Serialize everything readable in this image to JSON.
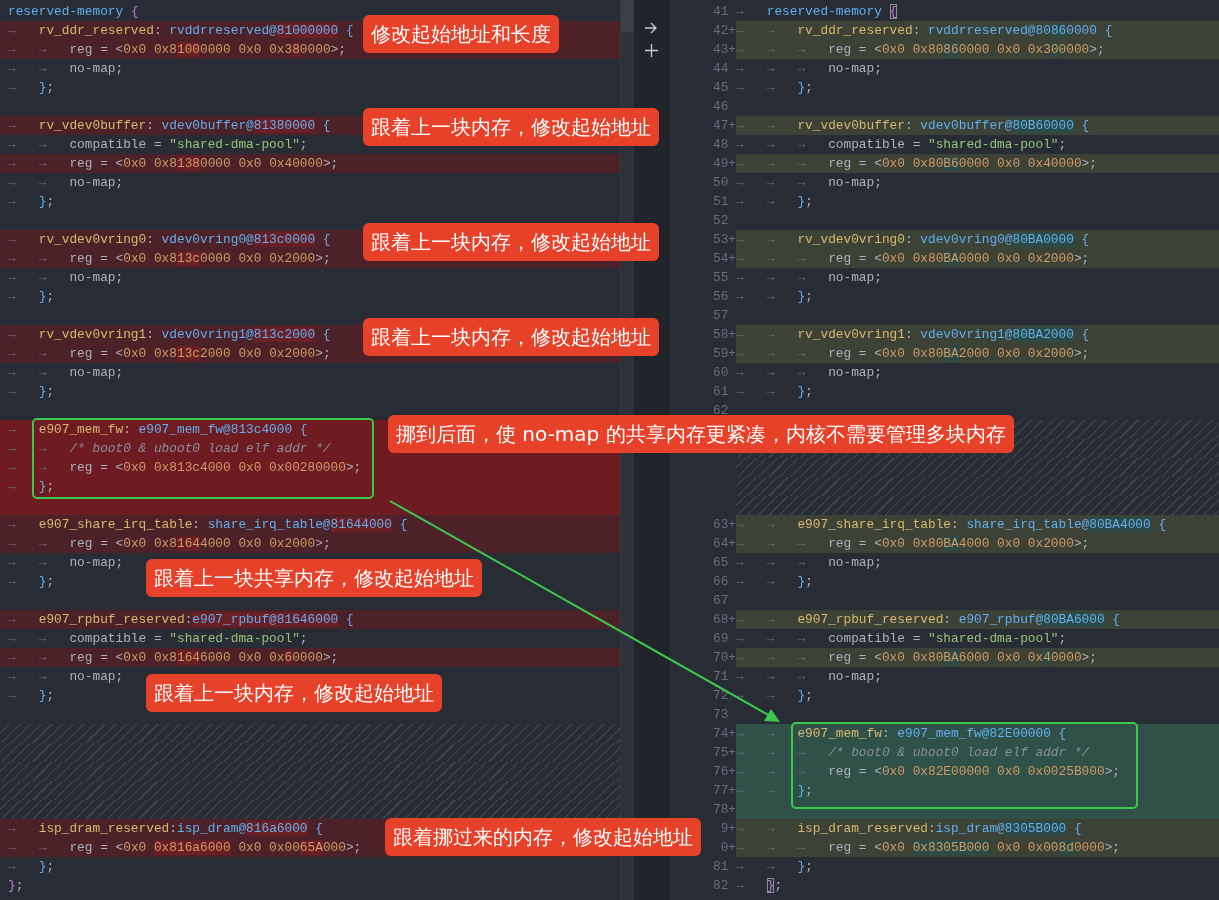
{
  "left_pane": {
    "lines": [
      {
        "kind": "normal",
        "segments": [
          {
            "text": "reserved-memory ",
            "kind": "label",
            "changed": false
          },
          {
            "text": "{",
            "kind": "bracket",
            "changed": false
          }
        ]
      },
      {
        "kind": "removed",
        "indent": "→   ",
        "segments": [
          {
            "text": "rv_ddr_reserved",
            "kind": "key",
            "changed": false
          },
          {
            "text": ": ",
            "kind": "plain",
            "changed": false
          },
          {
            "text": "rvddrreserved@",
            "kind": "label",
            "changed": false
          },
          {
            "text": "81000000",
            "kind": "label",
            "changed": true
          },
          {
            "text": " {",
            "kind": "brace",
            "changed": false
          }
        ]
      },
      {
        "kind": "removed",
        "indent": "→   →   ",
        "segments": [
          {
            "text": "reg = <",
            "kind": "plain",
            "changed": false
          },
          {
            "text": "0x0 0x8",
            "kind": "number",
            "changed": false
          },
          {
            "text": "100",
            "kind": "number",
            "changed": true
          },
          {
            "text": "0000 0x0 0x3",
            "kind": "number",
            "changed": false
          },
          {
            "text": "8",
            "kind": "number",
            "changed": true
          },
          {
            "text": "0000",
            "kind": "number",
            "changed": false
          },
          {
            "text": ">;",
            "kind": "plain",
            "changed": false
          }
        ]
      },
      {
        "kind": "normal",
        "indent": "→   →   ",
        "segments": [
          {
            "text": "no-map;",
            "kind": "plain",
            "changed": false
          }
        ]
      },
      {
        "kind": "normal",
        "indent": "→   ",
        "segments": [
          {
            "text": "}",
            "kind": "brace",
            "changed": false
          },
          {
            "text": ";",
            "kind": "plain",
            "changed": false
          }
        ]
      },
      {
        "kind": "normal"
      },
      {
        "kind": "removed",
        "indent": "→   ",
        "segments": [
          {
            "text": "rv_vdev0buffer",
            "kind": "key",
            "changed": false
          },
          {
            "text": ": ",
            "kind": "plain",
            "changed": false
          },
          {
            "text": "vdev0buffer@",
            "kind": "label",
            "changed": false
          },
          {
            "text": "81380000",
            "kind": "label",
            "changed": true
          },
          {
            "text": " {",
            "kind": "brace",
            "changed": false
          }
        ]
      },
      {
        "kind": "normal",
        "indent": "→   →   ",
        "segments": [
          {
            "text": "compatible = ",
            "kind": "plain",
            "changed": false
          },
          {
            "text": "\"shared-dma-pool\"",
            "kind": "string",
            "changed": false
          },
          {
            "text": ";",
            "kind": "plain",
            "changed": false
          }
        ]
      },
      {
        "kind": "removed",
        "indent": "→   →   ",
        "segments": [
          {
            "text": "reg = <",
            "kind": "plain",
            "changed": false
          },
          {
            "text": "0x0 0x8",
            "kind": "number",
            "changed": false
          },
          {
            "text": "138",
            "kind": "number",
            "changed": true
          },
          {
            "text": "0000 0x0 0x40000",
            "kind": "number",
            "changed": false
          },
          {
            "text": ">;",
            "kind": "plain",
            "changed": false
          }
        ]
      },
      {
        "kind": "normal",
        "indent": "→   →   ",
        "segments": [
          {
            "text": "no-map;",
            "kind": "plain",
            "changed": false
          }
        ]
      },
      {
        "kind": "normal",
        "indent": "→   ",
        "segments": [
          {
            "text": "}",
            "kind": "brace",
            "changed": false
          },
          {
            "text": ";",
            "kind": "plain",
            "changed": false
          }
        ]
      },
      {
        "kind": "normal"
      },
      {
        "kind": "removed",
        "indent": "→   ",
        "segments": [
          {
            "text": "rv_vdev0vring0",
            "kind": "key",
            "changed": false
          },
          {
            "text": ": ",
            "kind": "plain",
            "changed": false
          },
          {
            "text": "vdev0vring0@",
            "kind": "label",
            "changed": false
          },
          {
            "text": "813c0000",
            "kind": "label",
            "changed": true
          },
          {
            "text": " {",
            "kind": "brace",
            "changed": false
          }
        ]
      },
      {
        "kind": "removed",
        "indent": "→   →   ",
        "segments": [
          {
            "text": "reg = <",
            "kind": "plain",
            "changed": false
          },
          {
            "text": "0x0 0x8",
            "kind": "number",
            "changed": false
          },
          {
            "text": "13c",
            "kind": "number",
            "changed": true
          },
          {
            "text": "0000 0x0 0x2000",
            "kind": "number",
            "changed": false
          },
          {
            "text": ">;",
            "kind": "plain",
            "changed": false
          }
        ]
      },
      {
        "kind": "normal",
        "indent": "→   →   ",
        "segments": [
          {
            "text": "no-map;",
            "kind": "plain",
            "changed": false
          }
        ]
      },
      {
        "kind": "normal",
        "indent": "→   ",
        "segments": [
          {
            "text": "}",
            "kind": "brace",
            "changed": false
          },
          {
            "text": ";",
            "kind": "plain",
            "changed": false
          }
        ]
      },
      {
        "kind": "normal"
      },
      {
        "kind": "removed",
        "indent": "→   ",
        "segments": [
          {
            "text": "rv_vdev0vring1",
            "kind": "key",
            "changed": false
          },
          {
            "text": ": ",
            "kind": "plain",
            "changed": false
          },
          {
            "text": "vdev0vring1@",
            "kind": "label",
            "changed": false
          },
          {
            "text": "813c2000",
            "kind": "label",
            "changed": true
          },
          {
            "text": " {",
            "kind": "brace",
            "changed": false
          }
        ]
      },
      {
        "kind": "removed",
        "indent": "→   →   ",
        "segments": [
          {
            "text": "reg = <",
            "kind": "plain",
            "changed": false
          },
          {
            "text": "0x0 0x8",
            "kind": "number",
            "changed": false
          },
          {
            "text": "13c",
            "kind": "number",
            "changed": true
          },
          {
            "text": "2000 0x0 0x2000",
            "kind": "number",
            "changed": false
          },
          {
            "text": ">;",
            "kind": "plain",
            "changed": false
          }
        ]
      },
      {
        "kind": "normal",
        "indent": "→   →   ",
        "segments": [
          {
            "text": "no-map;",
            "kind": "plain",
            "changed": false
          }
        ]
      },
      {
        "kind": "normal",
        "indent": "→   ",
        "segments": [
          {
            "text": "}",
            "kind": "brace",
            "changed": false
          },
          {
            "text": ";",
            "kind": "plain",
            "changed": false
          }
        ]
      },
      {
        "kind": "normal"
      },
      {
        "kind": "deleted",
        "indent": "→   ",
        "segments": [
          {
            "text": "e907_mem_fw",
            "kind": "key"
          },
          {
            "text": ": ",
            "kind": "plain"
          },
          {
            "text": "e907_mem_fw@813c4000",
            "kind": "label"
          },
          {
            "text": " {",
            "kind": "brace"
          }
        ]
      },
      {
        "kind": "deleted",
        "indent": "→   →   ",
        "segments": [
          {
            "text": "/* boot0 & uboot0 load elf addr */",
            "kind": "comment"
          }
        ]
      },
      {
        "kind": "deleted",
        "indent": "→   →   ",
        "segments": [
          {
            "text": "reg = <",
            "kind": "plain"
          },
          {
            "text": "0x0 0x813c4000 0x0 0x00280000",
            "kind": "number"
          },
          {
            "text": ">;",
            "kind": "plain"
          }
        ]
      },
      {
        "kind": "deleted",
        "indent": "→   ",
        "segments": [
          {
            "text": "}",
            "kind": "brace"
          },
          {
            "text": ";",
            "kind": "plain"
          }
        ]
      },
      {
        "kind": "deleted"
      },
      {
        "kind": "removed",
        "indent": "→   ",
        "segments": [
          {
            "text": "e907_share_irq_table",
            "kind": "key",
            "changed": false
          },
          {
            "text": ": ",
            "kind": "plain",
            "changed": false
          },
          {
            "text": "share_irq_table@",
            "kind": "label",
            "changed": false
          },
          {
            "text": "81644000",
            "kind": "label",
            "changed": true
          },
          {
            "text": " {",
            "kind": "brace",
            "changed": false
          }
        ]
      },
      {
        "kind": "removed",
        "indent": "→   →   ",
        "segments": [
          {
            "text": "reg = <",
            "kind": "plain",
            "changed": false
          },
          {
            "text": "0x0 0x8",
            "kind": "number",
            "changed": false
          },
          {
            "text": "164",
            "kind": "number",
            "changed": true
          },
          {
            "text": "4000 0x0 0x2000",
            "kind": "number",
            "changed": false
          },
          {
            "text": ">;",
            "kind": "plain",
            "changed": false
          }
        ]
      },
      {
        "kind": "normal",
        "indent": "→   →   ",
        "segments": [
          {
            "text": "no-map;",
            "kind": "plain",
            "changed": false
          }
        ]
      },
      {
        "kind": "normal",
        "indent": "→   ",
        "segments": [
          {
            "text": "}",
            "kind": "brace",
            "changed": false
          },
          {
            "text": ";",
            "kind": "plain",
            "changed": false
          }
        ]
      },
      {
        "kind": "normal"
      },
      {
        "kind": "removed",
        "indent": "→   ",
        "segments": [
          {
            "text": "e907_rpbuf_reserved",
            "kind": "key",
            "changed": false
          },
          {
            "text": ":",
            "kind": "plain",
            "changed": false
          },
          {
            "text": "e907_rpbuf@81646000",
            "kind": "label",
            "changed": true
          },
          {
            "text": " {",
            "kind": "brace",
            "changed": false
          }
        ]
      },
      {
        "kind": "normal",
        "indent": "→   →   ",
        "segments": [
          {
            "text": "compatible = ",
            "kind": "plain",
            "changed": false
          },
          {
            "text": "\"shared-dma-pool\"",
            "kind": "string",
            "changed": false
          },
          {
            "text": ";",
            "kind": "plain",
            "changed": false
          }
        ]
      },
      {
        "kind": "removed",
        "indent": "→   →   ",
        "segments": [
          {
            "text": "reg = <",
            "kind": "plain",
            "changed": false
          },
          {
            "text": "0x0 0x8",
            "kind": "number",
            "changed": false
          },
          {
            "text": "164",
            "kind": "number",
            "changed": true
          },
          {
            "text": "6000 0x0 0x",
            "kind": "number",
            "changed": false
          },
          {
            "text": "6",
            "kind": "number",
            "changed": true
          },
          {
            "text": "0000",
            "kind": "number",
            "changed": false
          },
          {
            "text": ">;",
            "kind": "plain",
            "changed": false
          }
        ]
      },
      {
        "kind": "normal",
        "indent": "→   →   ",
        "segments": [
          {
            "text": "no-map;",
            "kind": "plain",
            "changed": false
          }
        ]
      },
      {
        "kind": "normal",
        "indent": "→   ",
        "segments": [
          {
            "text": "}",
            "kind": "brace",
            "changed": false
          },
          {
            "text": ";",
            "kind": "plain",
            "changed": false
          }
        ]
      },
      {
        "kind": "normal"
      },
      {
        "kind": "filler"
      },
      {
        "kind": "filler"
      },
      {
        "kind": "filler"
      },
      {
        "kind": "filler"
      },
      {
        "kind": "filler"
      },
      {
        "kind": "removed",
        "indent": "→   ",
        "segments": [
          {
            "text": "isp_dram_reserved",
            "kind": "key",
            "changed": false
          },
          {
            "text": ":",
            "kind": "plain",
            "changed": false
          },
          {
            "text": "isp_dram@",
            "kind": "label",
            "changed": false
          },
          {
            "text": "816a6000",
            "kind": "label",
            "changed": true
          },
          {
            "text": " {",
            "kind": "brace",
            "changed": false
          }
        ]
      },
      {
        "kind": "removed",
        "indent": "→   →   ",
        "segments": [
          {
            "text": "reg = <",
            "kind": "plain",
            "changed": false
          },
          {
            "text": "0x0 ",
            "kind": "number",
            "changed": false
          },
          {
            "text": "0x816a6000",
            "kind": "number",
            "changed": true
          },
          {
            "text": " 0x0 0x00",
            "kind": "number",
            "changed": false
          },
          {
            "text": "65A",
            "kind": "number",
            "changed": true
          },
          {
            "text": "000",
            "kind": "number",
            "changed": false
          },
          {
            "text": ">;",
            "kind": "plain",
            "changed": false
          }
        ]
      },
      {
        "kind": "normal",
        "indent": "→   ",
        "segments": [
          {
            "text": "}",
            "kind": "brace",
            "changed": false
          },
          {
            "text": ";",
            "kind": "plain",
            "changed": false
          }
        ]
      },
      {
        "kind": "normal",
        "segments": [
          {
            "text": "}",
            "kind": "bracket",
            "changed": false
          },
          {
            "text": ";",
            "kind": "plain",
            "changed": false
          }
        ]
      }
    ]
  },
  "right_pane": {
    "lines": [
      {
        "number": "41",
        "kind": "normal",
        "indent": "→   ",
        "segments": [
          {
            "text": "reserved-memory ",
            "kind": "label",
            "changed": false
          },
          {
            "text": "{",
            "kind": "matched_bracket",
            "changed": false
          }
        ]
      },
      {
        "number": "42+",
        "kind": "added",
        "indent": "→   →   ",
        "segments": [
          {
            "text": "rv_ddr_reserved",
            "kind": "key",
            "changed": false
          },
          {
            "text": ": ",
            "kind": "plain",
            "changed": false
          },
          {
            "text": "rvddrreserved@80",
            "kind": "label",
            "changed": false
          },
          {
            "text": "86",
            "kind": "label",
            "changed": true
          },
          {
            "text": "0000",
            "kind": "label",
            "changed": false
          },
          {
            "text": " {",
            "kind": "brace",
            "changed": false
          }
        ]
      },
      {
        "number": "43+",
        "kind": "added",
        "indent": "→   →   →   ",
        "segments": [
          {
            "text": "reg = <",
            "kind": "plain",
            "changed": false
          },
          {
            "text": "0x0 0x80",
            "kind": "number",
            "changed": false
          },
          {
            "text": "86",
            "kind": "number",
            "changed": true
          },
          {
            "text": "0000 0x0 0x3",
            "kind": "number",
            "changed": false
          },
          {
            "text": "0",
            "kind": "number",
            "changed": true
          },
          {
            "text": "0000",
            "kind": "number",
            "changed": false
          },
          {
            "text": ">;",
            "kind": "plain",
            "changed": false
          }
        ]
      },
      {
        "number": "44",
        "kind": "normal",
        "indent": "→   →   →   ",
        "segments": [
          {
            "text": "no-map;",
            "kind": "plain",
            "changed": false
          }
        ]
      },
      {
        "number": "45",
        "kind": "normal",
        "indent": "→   →   ",
        "segments": [
          {
            "text": "}",
            "kind": "brace",
            "changed": false
          },
          {
            "text": ";",
            "kind": "plain",
            "changed": false
          }
        ]
      },
      {
        "number": "46",
        "kind": "normal"
      },
      {
        "number": "47+",
        "kind": "added",
        "indent": "→   →   ",
        "segments": [
          {
            "text": "rv_vdev0buffer",
            "kind": "key",
            "changed": false
          },
          {
            "text": ": ",
            "kind": "plain",
            "changed": false
          },
          {
            "text": "vdev0buffer@",
            "kind": "label",
            "changed": false
          },
          {
            "text": "80B60000",
            "kind": "label",
            "changed": true
          },
          {
            "text": " {",
            "kind": "brace",
            "changed": false
          }
        ]
      },
      {
        "number": "48",
        "kind": "normal",
        "indent": "→   →   →   ",
        "segments": [
          {
            "text": "compatible = ",
            "kind": "plain",
            "changed": false
          },
          {
            "text": "\"shared-dma-pool\"",
            "kind": "string",
            "changed": false
          },
          {
            "text": ";",
            "kind": "plain",
            "changed": false
          }
        ]
      },
      {
        "number": "49+",
        "kind": "added",
        "indent": "→   →   →   ",
        "segments": [
          {
            "text": "reg = <",
            "kind": "plain",
            "changed": false
          },
          {
            "text": "0x0 0x80",
            "kind": "number",
            "changed": false
          },
          {
            "text": "B6",
            "kind": "number",
            "changed": true
          },
          {
            "text": "0000 0x0 0x40000",
            "kind": "number",
            "changed": false
          },
          {
            "text": ">;",
            "kind": "plain",
            "changed": false
          }
        ]
      },
      {
        "number": "50",
        "kind": "normal",
        "indent": "→   →   →   ",
        "segments": [
          {
            "text": "no-map;",
            "kind": "plain",
            "changed": false
          }
        ]
      },
      {
        "number": "51",
        "kind": "normal",
        "indent": "→   →   ",
        "segments": [
          {
            "text": "}",
            "kind": "brace",
            "changed": false
          },
          {
            "text": ";",
            "kind": "plain",
            "changed": false
          }
        ]
      },
      {
        "number": "52",
        "kind": "normal"
      },
      {
        "number": "53+",
        "kind": "added",
        "indent": "→   →   ",
        "segments": [
          {
            "text": "rv_vdev0vring0",
            "kind": "key",
            "changed": false
          },
          {
            "text": ": ",
            "kind": "plain",
            "changed": false
          },
          {
            "text": "vdev0vring0@",
            "kind": "label",
            "changed": false
          },
          {
            "text": "80BA0000",
            "kind": "label",
            "changed": true
          },
          {
            "text": " {",
            "kind": "brace",
            "changed": false
          }
        ]
      },
      {
        "number": "54+",
        "kind": "added",
        "indent": "→   →   →   ",
        "segments": [
          {
            "text": "reg = <",
            "kind": "plain",
            "changed": false
          },
          {
            "text": "0x0 0x80",
            "kind": "number",
            "changed": false
          },
          {
            "text": "BA",
            "kind": "number",
            "changed": true
          },
          {
            "text": "0000 0x0 0x2000",
            "kind": "number",
            "changed": false
          },
          {
            "text": ">;",
            "kind": "plain",
            "changed": false
          }
        ]
      },
      {
        "number": "55",
        "kind": "normal",
        "indent": "→   →   →   ",
        "segments": [
          {
            "text": "no-map;",
            "kind": "plain",
            "changed": false
          }
        ]
      },
      {
        "number": "56",
        "kind": "normal",
        "indent": "→   →   ",
        "segments": [
          {
            "text": "}",
            "kind": "brace",
            "changed": false
          },
          {
            "text": ";",
            "kind": "plain",
            "changed": false
          }
        ]
      },
      {
        "number": "57",
        "kind": "normal"
      },
      {
        "number": "58+",
        "kind": "added",
        "indent": "→   →   ",
        "segments": [
          {
            "text": "rv_vdev0vring1",
            "kind": "key",
            "changed": false
          },
          {
            "text": ": ",
            "kind": "plain",
            "changed": false
          },
          {
            "text": "vdev0vring1@",
            "kind": "label",
            "changed": false
          },
          {
            "text": "80BA2000",
            "kind": "label",
            "changed": true
          },
          {
            "text": " {",
            "kind": "brace",
            "changed": false
          }
        ]
      },
      {
        "number": "59+",
        "kind": "added",
        "indent": "→   →   →   ",
        "segments": [
          {
            "text": "reg = <",
            "kind": "plain",
            "changed": false
          },
          {
            "text": "0x0 0x80",
            "kind": "number",
            "changed": false
          },
          {
            "text": "BA",
            "kind": "number",
            "changed": true
          },
          {
            "text": "2000 0x0 0x2000",
            "kind": "number",
            "changed": false
          },
          {
            "text": ">;",
            "kind": "plain",
            "changed": false
          }
        ]
      },
      {
        "number": "60",
        "kind": "normal",
        "indent": "→   →   →   ",
        "segments": [
          {
            "text": "no-map;",
            "kind": "plain",
            "changed": false
          }
        ]
      },
      {
        "number": "61",
        "kind": "normal",
        "indent": "→   →   ",
        "segments": [
          {
            "text": "}",
            "kind": "brace",
            "changed": false
          },
          {
            "text": ";",
            "kind": "plain",
            "changed": false
          }
        ]
      },
      {
        "number": "62",
        "kind": "normal"
      },
      {
        "kind": "filler"
      },
      {
        "kind": "filler"
      },
      {
        "kind": "filler"
      },
      {
        "kind": "filler"
      },
      {
        "kind": "filler"
      },
      {
        "number": "63+",
        "kind": "added",
        "indent": "→   →   ",
        "segments": [
          {
            "text": "e907_share_irq_table",
            "kind": "key",
            "changed": false
          },
          {
            "text": ": ",
            "kind": "plain",
            "changed": false
          },
          {
            "text": "share_irq_table@",
            "kind": "label",
            "changed": false
          },
          {
            "text": "80BA4000",
            "kind": "label",
            "changed": true
          },
          {
            "text": " {",
            "kind": "brace",
            "changed": false
          }
        ]
      },
      {
        "number": "64+",
        "kind": "added",
        "indent": "→   →   →   ",
        "segments": [
          {
            "text": "reg = <",
            "kind": "plain",
            "changed": false
          },
          {
            "text": "0x0 0x80",
            "kind": "number",
            "changed": false
          },
          {
            "text": "BA",
            "kind": "number",
            "changed": true
          },
          {
            "text": "4000 0x0 0x2000",
            "kind": "number",
            "changed": false
          },
          {
            "text": ">;",
            "kind": "plain",
            "changed": false
          }
        ]
      },
      {
        "number": "65",
        "kind": "normal",
        "indent": "→   →   →   ",
        "segments": [
          {
            "text": "no-map;",
            "kind": "plain",
            "changed": false
          }
        ]
      },
      {
        "number": "66",
        "kind": "normal",
        "indent": "→   →   ",
        "segments": [
          {
            "text": "}",
            "kind": "brace",
            "changed": false
          },
          {
            "text": ";",
            "kind": "plain",
            "changed": false
          }
        ]
      },
      {
        "number": "67",
        "kind": "normal"
      },
      {
        "number": "68+",
        "kind": "added",
        "indent": "→   →   ",
        "segments": [
          {
            "text": "e907_rpbuf_reserved",
            "kind": "key",
            "changed": false
          },
          {
            "text": ": ",
            "kind": "plain",
            "changed": false
          },
          {
            "text": "e907_rpbuf@",
            "kind": "label",
            "changed": false
          },
          {
            "text": "80BA6000",
            "kind": "label",
            "changed": true
          },
          {
            "text": " {",
            "kind": "brace",
            "changed": false
          }
        ]
      },
      {
        "number": "69",
        "kind": "normal",
        "indent": "→   →   →   ",
        "segments": [
          {
            "text": "compatible = ",
            "kind": "plain",
            "changed": false
          },
          {
            "text": "\"shared-dma-pool\"",
            "kind": "string",
            "changed": false
          },
          {
            "text": ";",
            "kind": "plain",
            "changed": false
          }
        ]
      },
      {
        "number": "70+",
        "kind": "added",
        "indent": "→   →   →   ",
        "segments": [
          {
            "text": "reg = <",
            "kind": "plain",
            "changed": false
          },
          {
            "text": "0x0 0x80",
            "kind": "number",
            "changed": false
          },
          {
            "text": "BA",
            "kind": "number",
            "changed": true
          },
          {
            "text": "6000 0x0 0x",
            "kind": "number",
            "changed": false
          },
          {
            "text": "4",
            "kind": "number",
            "changed": true
          },
          {
            "text": "0000",
            "kind": "number",
            "changed": false
          },
          {
            "text": ">;",
            "kind": "plain",
            "changed": false
          }
        ]
      },
      {
        "number": "71",
        "kind": "normal",
        "indent": "→   →   →   ",
        "segments": [
          {
            "text": "no-map;",
            "kind": "plain",
            "changed": false
          }
        ]
      },
      {
        "number": "72",
        "kind": "normal",
        "indent": "→   →   ",
        "segments": [
          {
            "text": "}",
            "kind": "brace",
            "changed": false
          },
          {
            "text": ";",
            "kind": "plain",
            "changed": false
          }
        ]
      },
      {
        "number": "73",
        "kind": "normal"
      },
      {
        "number": "74+",
        "kind": "moved",
        "indent": "→   →   ",
        "segments": [
          {
            "text": "e907_mem_fw",
            "kind": "key"
          },
          {
            "text": ": ",
            "kind": "plain"
          },
          {
            "text": "e907_mem_fw@82E00000",
            "kind": "label"
          },
          {
            "text": " {",
            "kind": "brace"
          }
        ]
      },
      {
        "number": "75+",
        "kind": "moved",
        "indent": "→   →   →   ",
        "segments": [
          {
            "text": "/* boot0 & uboot0 load elf addr */",
            "kind": "comment"
          }
        ]
      },
      {
        "number": "76+",
        "kind": "moved",
        "indent": "→   →   →   ",
        "segments": [
          {
            "text": "reg = <",
            "kind": "plain"
          },
          {
            "text": "0x0 0x82E00000 0x0 0x0025B000",
            "kind": "number"
          },
          {
            "text": ">;",
            "kind": "plain"
          }
        ]
      },
      {
        "number": "77+",
        "kind": "moved",
        "indent": "→   →   ",
        "segments": [
          {
            "text": "}",
            "kind": "brace"
          },
          {
            "text": ";",
            "kind": "plain"
          }
        ]
      },
      {
        "number": "78+",
        "kind": "moved"
      },
      {
        "number": "9+",
        "kind": "added",
        "indent": "→   →   ",
        "segments": [
          {
            "text": "isp_dram_reserved",
            "kind": "key",
            "changed": false
          },
          {
            "text": ":",
            "kind": "plain",
            "changed": false
          },
          {
            "text": "isp_dram@",
            "kind": "label",
            "changed": false
          },
          {
            "text": "8305B000",
            "kind": "label",
            "changed": true
          },
          {
            "text": " {",
            "kind": "brace",
            "changed": false
          }
        ]
      },
      {
        "number": "0+",
        "kind": "added",
        "indent": "→   →   →   ",
        "segments": [
          {
            "text": "reg = <",
            "kind": "plain",
            "changed": false
          },
          {
            "text": "0x0 ",
            "kind": "number",
            "changed": false
          },
          {
            "text": "0x8305B000",
            "kind": "number",
            "changed": true
          },
          {
            "text": " 0x0 0x00",
            "kind": "number",
            "changed": false
          },
          {
            "text": "8d",
            "kind": "number",
            "changed": true
          },
          {
            "text": "0000",
            "kind": "number",
            "changed": false
          },
          {
            "text": ">;",
            "kind": "plain",
            "changed": false
          }
        ]
      },
      {
        "number": "81",
        "kind": "normal",
        "indent": "→   →   ",
        "segments": [
          {
            "text": "}",
            "kind": "brace",
            "changed": false
          },
          {
            "text": ";",
            "kind": "plain",
            "changed": false
          }
        ]
      },
      {
        "number": "82",
        "kind": "normal",
        "indent": "→   ",
        "segments": [
          {
            "text": "}",
            "kind": "matched_bracket",
            "changed": false
          },
          {
            "text": ";",
            "kind": "plain",
            "changed": false
          }
        ]
      }
    ]
  },
  "annotations": [
    {
      "text": "修改起始地址和长度"
    },
    {
      "text": "跟着上一块内存，修改起始地址"
    },
    {
      "text": "跟着上一块内存，修改起始地址"
    },
    {
      "text": "跟着上一块内存，修改起始地址"
    },
    {
      "text": "挪到后面，使 no-map 的共享内存更紧凑，内核不需要管理多块内存"
    },
    {
      "text": "跟着上一块共享内存，修改起始地址"
    },
    {
      "text": "跟着上一块内存，修改起始地址"
    },
    {
      "text": "跟着挪过来的内存，修改起始地址"
    }
  ]
}
